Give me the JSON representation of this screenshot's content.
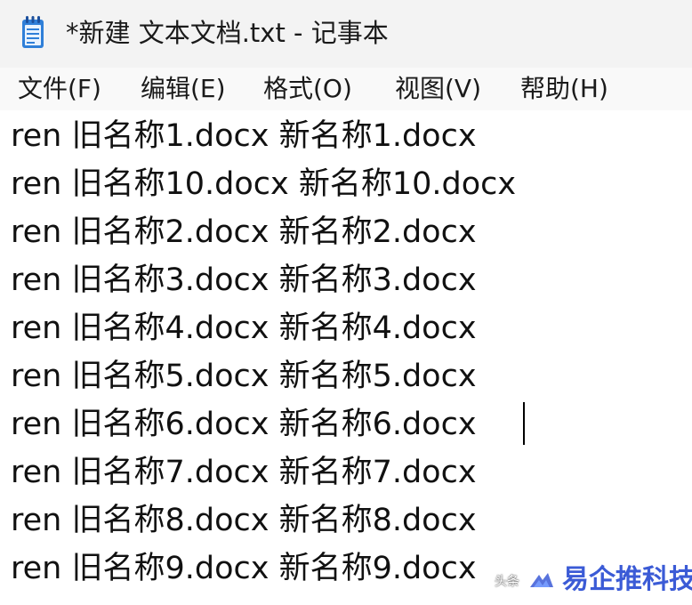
{
  "window": {
    "title": "*新建 文本文档.txt - 记事本",
    "icon": "notepad-icon"
  },
  "menu": {
    "items": [
      {
        "label": "文件(F)"
      },
      {
        "label": "编辑(E)"
      },
      {
        "label": "格式(O)"
      },
      {
        "label": "视图(V)"
      },
      {
        "label": "帮助(H)"
      }
    ]
  },
  "editor": {
    "lines": [
      "ren 旧名称1.docx 新名称1.docx",
      "ren 旧名称10.docx 新名称10.docx",
      "ren 旧名称2.docx 新名称2.docx",
      "ren 旧名称3.docx 新名称3.docx",
      "ren 旧名称4.docx 新名称4.docx",
      "ren 旧名称5.docx 新名称5.docx",
      "ren 旧名称6.docx 新名称6.docx",
      "ren 旧名称7.docx 新名称7.docx",
      "ren 旧名称8.docx 新名称8.docx",
      "ren 旧名称9.docx 新名称9.docx"
    ]
  },
  "watermark": {
    "small_text": "头条",
    "brand_text": "易企推科技",
    "brand_color": "#3b5bd6"
  },
  "colors": {
    "titlebar_bg": "#f3f3f3",
    "menubar_bg": "#f9f9f9",
    "editor_bg": "#ffffff",
    "icon_blue": "#2f7fd8"
  }
}
